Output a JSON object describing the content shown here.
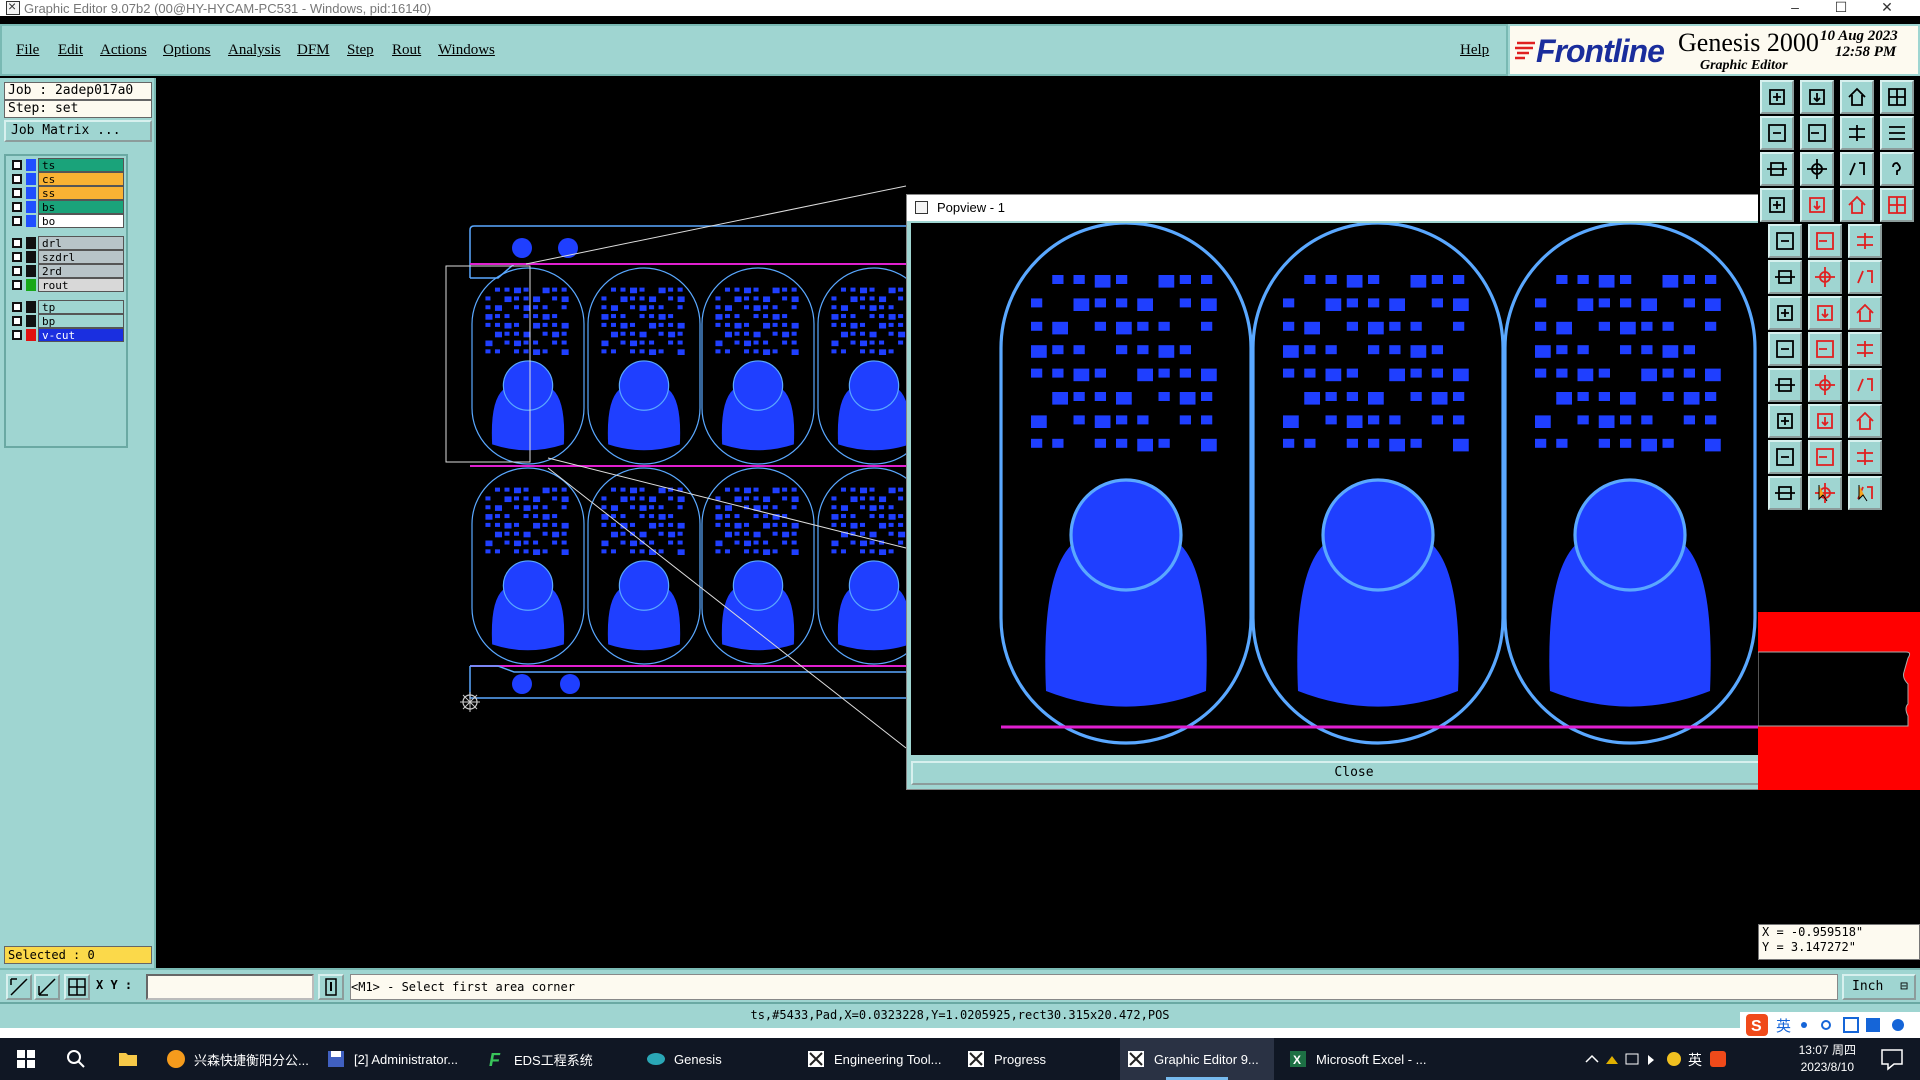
{
  "window": {
    "title": "Graphic Editor 9.07b2 (00@HY-HYCAM-PC531 - Windows, pid:16140)"
  },
  "menu": {
    "items": [
      "File",
      "Edit",
      "Actions",
      "Options",
      "Analysis",
      "DFM",
      "Step",
      "Rout",
      "Windows"
    ],
    "help": "Help"
  },
  "brand": {
    "logo": "Frontline",
    "product": "Genesis 2000",
    "subtitle": "Graphic Editor",
    "date": "10 Aug 2023",
    "time": "12:58 PM"
  },
  "job": {
    "job_label": "Job : 2adep017a0",
    "step_label": "Step: set",
    "matrix_button": "Job Matrix ..."
  },
  "layers": [
    {
      "name": "ts",
      "color": "#1f4fff",
      "bg": "#1aa37a"
    },
    {
      "name": "cs",
      "color": "#1f4fff",
      "bg": "#f9b233"
    },
    {
      "name": "ss",
      "color": "#1f4fff",
      "bg": "#f9b233"
    },
    {
      "name": "bs",
      "color": "#1f4fff",
      "bg": "#1aa37a"
    },
    {
      "name": "bo",
      "color": "#1f4fff",
      "bg": "#ffffff"
    },
    {
      "name": "drl",
      "color": "#111111",
      "bg": "#b8c4c8"
    },
    {
      "name": "szdrl",
      "color": "#111111",
      "bg": "#b8c4c8"
    },
    {
      "name": "2rd",
      "color": "#111111",
      "bg": "#b8c4c8"
    },
    {
      "name": "rout",
      "color": "#18a818",
      "bg": "#d8d8d8"
    },
    {
      "name": "tp",
      "color": "#111111",
      "bg": "#9fd5d1"
    },
    {
      "name": "bp",
      "color": "#111111",
      "bg": "#9fd5d1"
    },
    {
      "name": "v-cut",
      "color": "#e01010",
      "bg": "#1a2fe0"
    }
  ],
  "selected": "Selected : 0",
  "popview": {
    "title": "Popview - 1",
    "close": "Close"
  },
  "command": {
    "xy_label": "X Y :",
    "xy_value": "",
    "prompt": "<M1> - Select first area corner",
    "unit": "Inch"
  },
  "coords": {
    "x": "X = -0.959518\"",
    "y": "Y = 3.147272\""
  },
  "status": "ts,#5433,Pad,X=0.0323228,Y=1.0205925,rect30.315x20.472,POS",
  "taskbar": {
    "items": [
      "兴森快捷衡阳分公...",
      "[2] Administrator...",
      "EDS工程系统",
      "Genesis",
      "Engineering Tool...",
      "Progress",
      "Graphic Editor 9...",
      "Microsoft Excel - ..."
    ],
    "clock_time": "13:07 周四",
    "clock_date": "2023/8/10",
    "ime": "英"
  },
  "colors": {
    "panel": "#9fd5d1",
    "pad_blue": "#1f3fff",
    "outline_blue": "#5aa8ff",
    "vcut_magenta": "#e020d0"
  }
}
